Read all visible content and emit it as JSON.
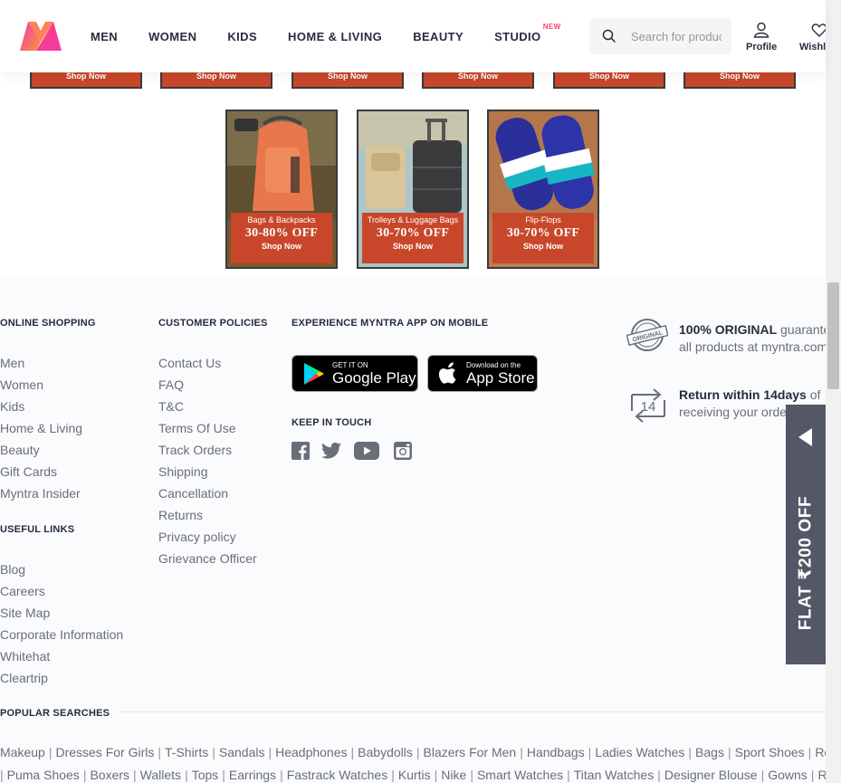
{
  "header": {
    "logo": "myntra-logo",
    "nav": [
      "MEN",
      "WOMEN",
      "KIDS",
      "HOME & LIVING",
      "BEAUTY",
      "STUDIO"
    ],
    "studio_badge": "NEW",
    "search_placeholder": "Search for products, brands and more",
    "profile_label": "Profile",
    "wishlist_label": "Wishlist"
  },
  "banners_top": {
    "cta": "Shop Now",
    "count": 6
  },
  "promos": [
    {
      "title": "Bags & Backpacks",
      "offer": "30-80% OFF",
      "cta": "Shop Now"
    },
    {
      "title": "Trolleys & Luggage Bags",
      "offer": "30-70% OFF",
      "cta": "Shop Now"
    },
    {
      "title": "Flip-Flops",
      "offer": "30-70% OFF",
      "cta": "Shop Now"
    }
  ],
  "footer": {
    "online_shopping": {
      "title": "ONLINE SHOPPING",
      "links": [
        "Men",
        "Women",
        "Kids",
        "Home & Living",
        "Beauty",
        "Gift Cards",
        "Myntra Insider"
      ]
    },
    "useful_links": {
      "title": "USEFUL LINKS",
      "links": [
        "Blog",
        "Careers",
        "Site Map",
        "Corporate Information",
        "Whitehat",
        "Cleartrip"
      ]
    },
    "customer_policies": {
      "title": "CUSTOMER POLICIES",
      "links": [
        "Contact Us",
        "FAQ",
        "T&C",
        "Terms Of Use",
        "Track Orders",
        "Shipping",
        "Cancellation",
        "Returns",
        "Privacy policy",
        "Grievance Officer"
      ]
    },
    "app": {
      "title": "EXPERIENCE MYNTRA APP ON MOBILE",
      "google_small": "GET IT ON",
      "google_big": "Google Play",
      "apple_small": "Download on the",
      "apple_big": "App Store"
    },
    "keep_in_touch": {
      "title": "KEEP IN TOUCH",
      "icons": [
        "facebook-icon",
        "twitter-icon",
        "youtube-icon",
        "instagram-icon"
      ]
    },
    "promise_original": {
      "bold": "100% ORIGINAL",
      "rest": " guarantee for",
      "line2": "all products at myntra.com"
    },
    "promise_return": {
      "bold": "Return within 14days",
      "rest": " of",
      "line2": "receiving your order"
    },
    "popular_title": "POPULAR SEARCHES",
    "popular_row1": [
      "Makeup",
      "Dresses For Girls",
      "T-Shirts",
      "Sandals",
      "Headphones",
      "Babydolls",
      "Blazers For Men",
      "Handbags",
      "Ladies Watches",
      "Bags",
      "Sport Shoes",
      "Reebok Shoes"
    ],
    "popular_row2": [
      "Puma Shoes",
      "Boxers",
      "Wallets",
      "Tops",
      "Earrings",
      "Fastrack Watches",
      "Kurtis",
      "Nike",
      "Smart Watches",
      "Titan Watches",
      "Designer Blouse",
      "Gowns",
      "Rings"
    ]
  },
  "side_offer": {
    "text": "FLAT ₹200 OFF"
  },
  "colors": {
    "accent": "#ff3f6c",
    "banner": "#c8472b",
    "offer_bg": "#535766"
  }
}
